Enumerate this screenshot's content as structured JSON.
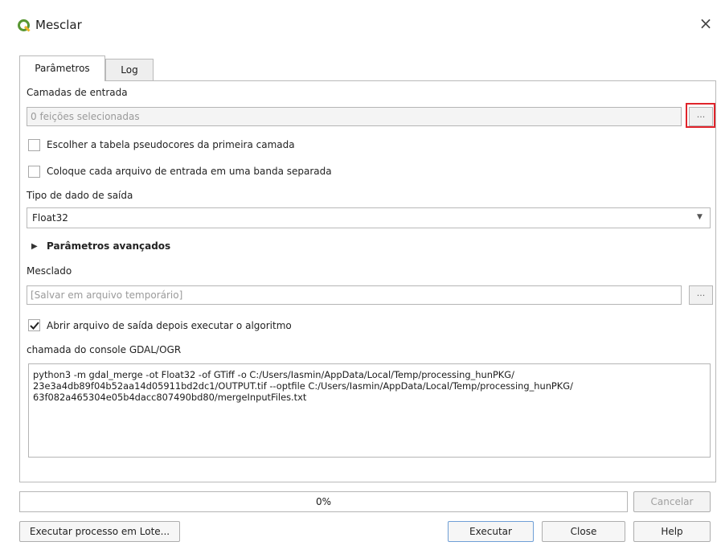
{
  "window": {
    "title": "Mesclar",
    "close_symbol": "×",
    "accent": "#589632"
  },
  "tabs": [
    {
      "label": "Parâmetros",
      "active": true
    },
    {
      "label": "Log",
      "active": false
    }
  ],
  "params": {
    "input_layers_label": "Camadas de entrada",
    "input_layers_value": "0 feições selecionadas",
    "browse_label": "...",
    "pseudocolor_label": "Escolher a tabela pseudocores da primeira camada",
    "pseudocolor_checked": false,
    "separate_band_label": "Coloque cada arquivo de entrada em uma banda separada",
    "separate_band_checked": false,
    "output_type_label": "Tipo de dado de saída",
    "output_type_value": "Float32",
    "advanced_label": "Parâmetros avançados",
    "merged_label": "Mesclado",
    "merged_placeholder": "[Salvar em arquivo temporário]",
    "open_output_label": "Abrir arquivo de saída depois executar o algoritmo",
    "open_output_checked": true,
    "console_label": "chamada do console GDAL/OGR",
    "console_lines": [
      "python3 -m gdal_merge -ot Float32 -of GTiff -o C:/Users/Iasmin/AppData/Local/Temp/processing_hunPKG/",
      "23e3a4db89f04b52aa14d05911bd2dc1/OUTPUT.tif --optfile C:/Users/Iasmin/AppData/Local/Temp/processing_hunPKG/",
      "63f082a465304e05b4dacc807490bd80/mergeInputFiles.txt"
    ]
  },
  "footer": {
    "progress_text": "0%",
    "progress_value": 0,
    "cancel_label": "Cancelar",
    "batch_label": "Executar processo em Lote...",
    "run_label": "Executar",
    "close_label": "Close",
    "help_label": "Help"
  },
  "highlight_color": "#e0242b"
}
